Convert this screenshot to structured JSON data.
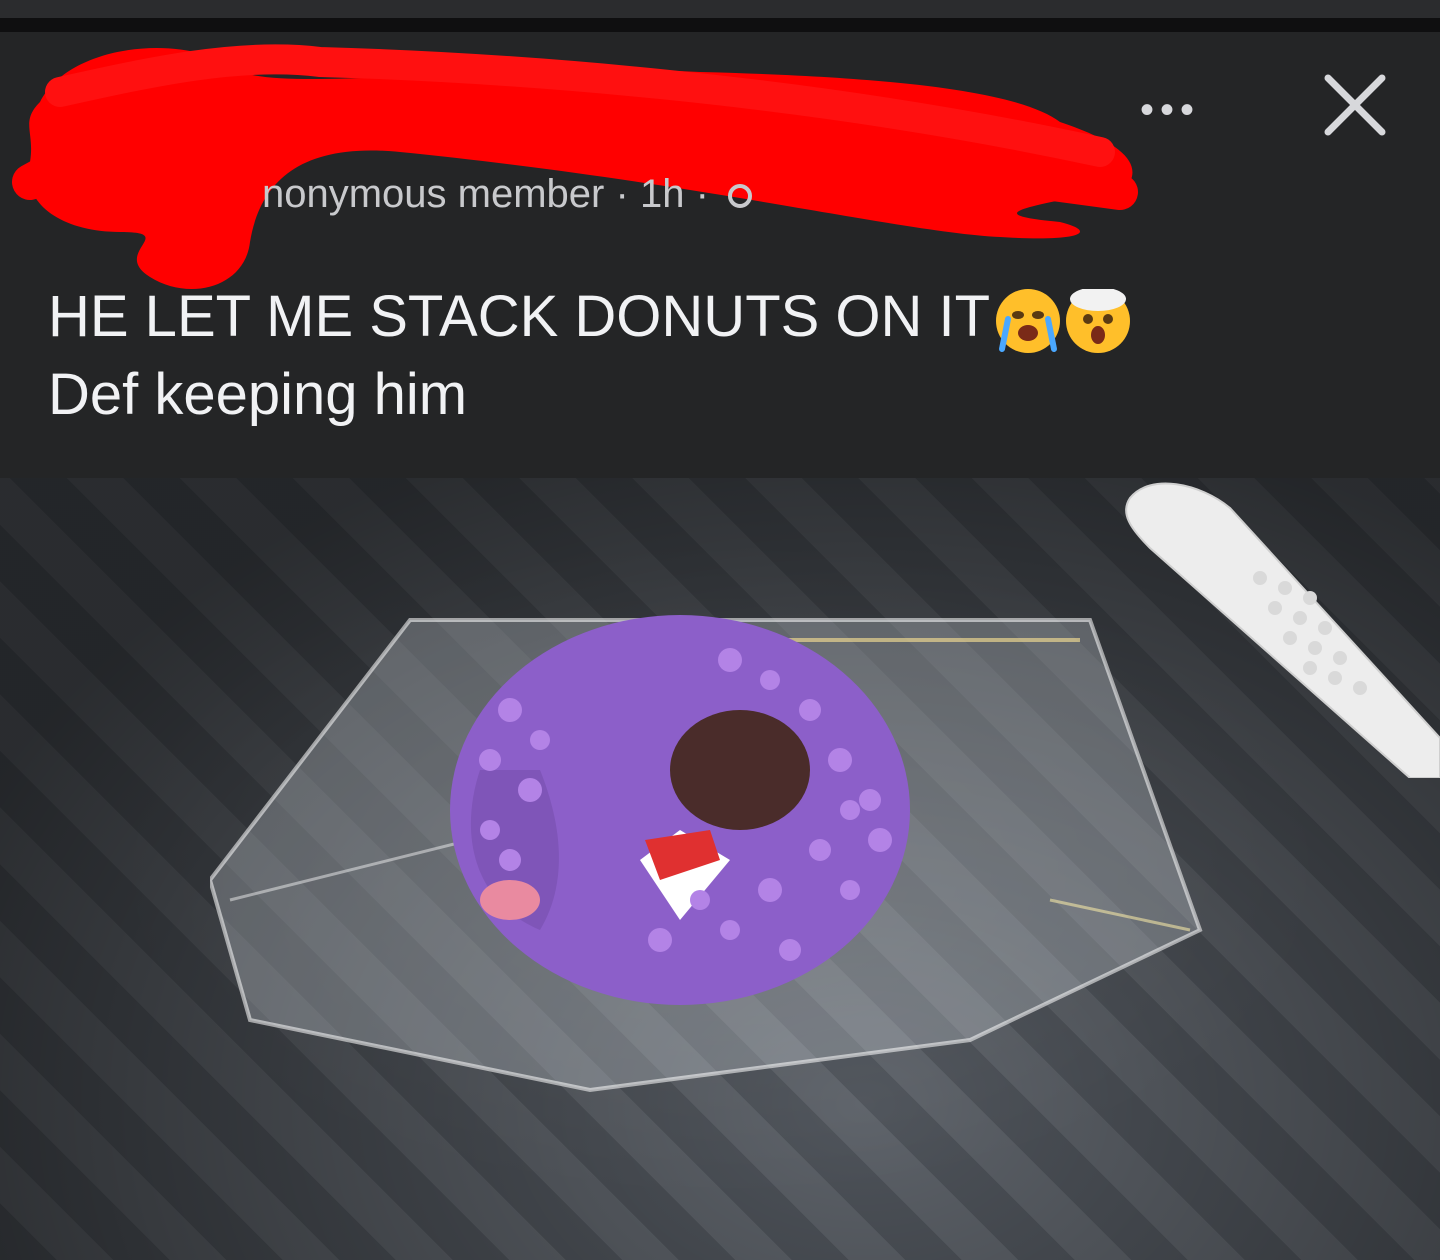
{
  "post": {
    "author_meta": "nonymous member",
    "separator": "·",
    "time": "1h",
    "text_line1": "HE LET ME STACK DONUTS ON IT",
    "text_line2": "Def keeping him"
  },
  "controls": {
    "more_label": "•••"
  },
  "icons": [
    "avatar",
    "globe-icon",
    "more-icon",
    "close-icon",
    "crying-emoji",
    "mind-blown-emoji"
  ],
  "colors": {
    "background": "#242526",
    "text": "#f1f2f4",
    "meta": "#c8c9cc",
    "redaction": "#ff0000",
    "donut": "#8c5fc9"
  }
}
